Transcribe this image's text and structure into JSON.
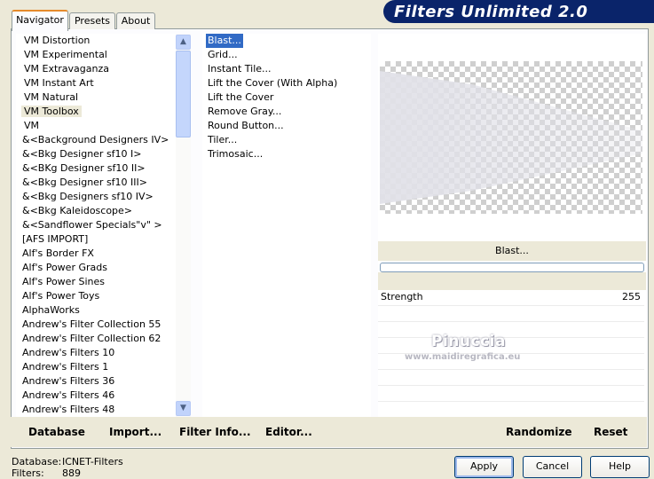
{
  "app": {
    "title": "Filters Unlimited 2.0"
  },
  "tabs": [
    {
      "label": "Navigator",
      "active": true
    },
    {
      "label": "Presets",
      "active": false
    },
    {
      "label": "About",
      "active": false
    }
  ],
  "categories": {
    "selected": "VM Toolbox",
    "items": [
      "VM Distortion",
      "VM Experimental",
      "VM Extravaganza",
      "VM Instant Art",
      "VM Natural",
      "VM Toolbox",
      "VM",
      "&<Background Designers IV>",
      "&<Bkg Designer sf10 I>",
      "&<BKg Designer sf10 II>",
      "&<Bkg Designer sf10 III>",
      "&<Bkg Designers sf10 IV>",
      "&<Bkg Kaleidoscope>",
      "&<Sandflower Specials\"v\" >",
      "[AFS IMPORT]",
      "Alf's Border FX",
      "Alf's Power Grads",
      "Alf's Power Sines",
      "Alf's Power Toys",
      "AlphaWorks",
      "Andrew's Filter Collection 55",
      "Andrew's Filter Collection 62",
      "Andrew's Filters 10",
      "Andrew's Filters 1",
      "Andrew's Filters 36",
      "Andrew's Filters 46",
      "Andrew's Filters 48"
    ]
  },
  "filters": {
    "selected": "Blast...",
    "items": [
      "Blast...",
      "Grid...",
      "Instant Tile...",
      "Lift the Cover (With Alpha)",
      "Lift the Cover",
      "Remove Gray...",
      "Round Button...",
      "Tiler...",
      "Trimosaic..."
    ]
  },
  "preview": {
    "filter_name": "Blast...",
    "progress": 0
  },
  "parameters": [
    {
      "name": "Strength",
      "value": "255"
    }
  ],
  "watermark": {
    "name": "Pinuccia",
    "url": "www.maidiregrafica.eu"
  },
  "bottom_actions": {
    "database": "Database",
    "import": "Import...",
    "filter_info": "Filter Info...",
    "editor": "Editor...",
    "randomize": "Randomize",
    "reset": "Reset"
  },
  "status": {
    "database_label": "Database:",
    "database_value": "ICNET-Filters",
    "filters_label": "Filters:",
    "filters_value": "889"
  },
  "dialog_buttons": {
    "apply": "Apply",
    "cancel": "Cancel",
    "help": "Help"
  },
  "colors": {
    "banner": "#0a246a",
    "selection": "#316ac5",
    "dialog_bg": "#ece9d8"
  }
}
